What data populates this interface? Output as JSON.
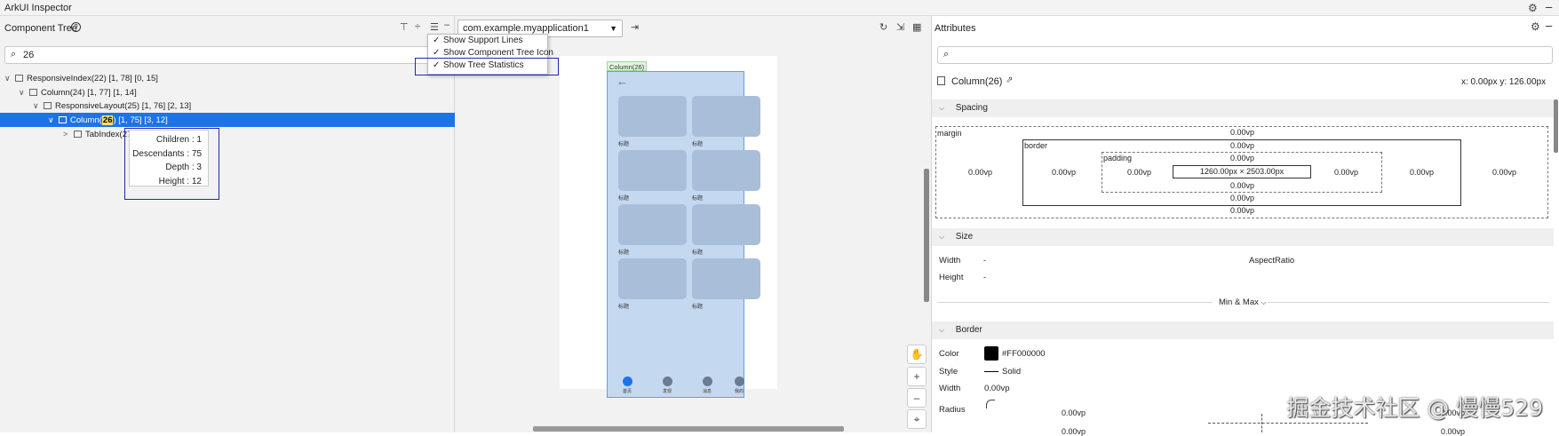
{
  "app_title": "ArkUI Inspector",
  "left_panel": {
    "title": "Component Tree",
    "search_value": "26",
    "tree": [
      {
        "label": "ResponsiveIndex(22) [1, 78] [0, 15]"
      },
      {
        "label": "Column(24) [1, 77] [1, 14]"
      },
      {
        "label": "ResponsiveLayout(25) [1, 76] [2, 13]"
      },
      {
        "label_before": "Column(",
        "label_hl": "26",
        "label_after": ") [1, 75] [3, 12]"
      },
      {
        "label": "TabIndex(27)"
      }
    ],
    "stats": {
      "children": "Children : 1",
      "descendants": "Descendants : 75",
      "depth": "Depth : 3",
      "height": "Height : 12"
    }
  },
  "menu": {
    "items": [
      {
        "label": "Show Support Lines",
        "checked": "✓"
      },
      {
        "label": "Show Component Tree Icon",
        "checked": "✓"
      },
      {
        "label": "Show Tree Statistics",
        "checked": "✓"
      }
    ]
  },
  "center_panel": {
    "app_select": "com.example.myapplication1",
    "phone_tag": "Column(26)",
    "card_caption": "标题",
    "tabs": [
      "首页",
      "发现",
      "消息",
      "我的"
    ]
  },
  "right_panel": {
    "title": "Attributes",
    "component_name": "Column(26)",
    "coords": "x: 0.00px  y: 126.00px",
    "spacing": {
      "header": "Spacing",
      "margin_label": "margin",
      "border_label": "border",
      "padding_label": "padding",
      "margin_top": "0.00vp",
      "margin_bottom": "0.00vp",
      "margin_left": "0.00vp",
      "margin_right": "0.00vp",
      "border_top": "0.00vp",
      "border_bottom": "0.00vp",
      "border_left": "0.00vp",
      "border_right": "0.00vp",
      "padding_top": "0.00vp",
      "padding_bottom": "0.00vp",
      "padding_left": "0.00vp",
      "padding_right": "0.00vp",
      "content": "1260.00px × 2503.00px"
    },
    "size": {
      "header": "Size",
      "width_label": "Width",
      "width_value": "-",
      "height_label": "Height",
      "height_value": "-",
      "aspect_label": "AspectRatio",
      "min_max": "Min & Max"
    },
    "border": {
      "header": "Border",
      "color_label": "Color",
      "color_value": "#FF000000",
      "style_label": "Style",
      "style_value": "Solid",
      "width_label": "Width",
      "width_value": "0.00vp",
      "radius_label": "Radius",
      "radius_value_1": "0.00vp",
      "radius_value_2": "0.00vp",
      "radius_value_3": "0.00vp",
      "radius_value_4": "0.00vp"
    }
  },
  "watermark": "掘金技术社区 @ 慢慢529"
}
